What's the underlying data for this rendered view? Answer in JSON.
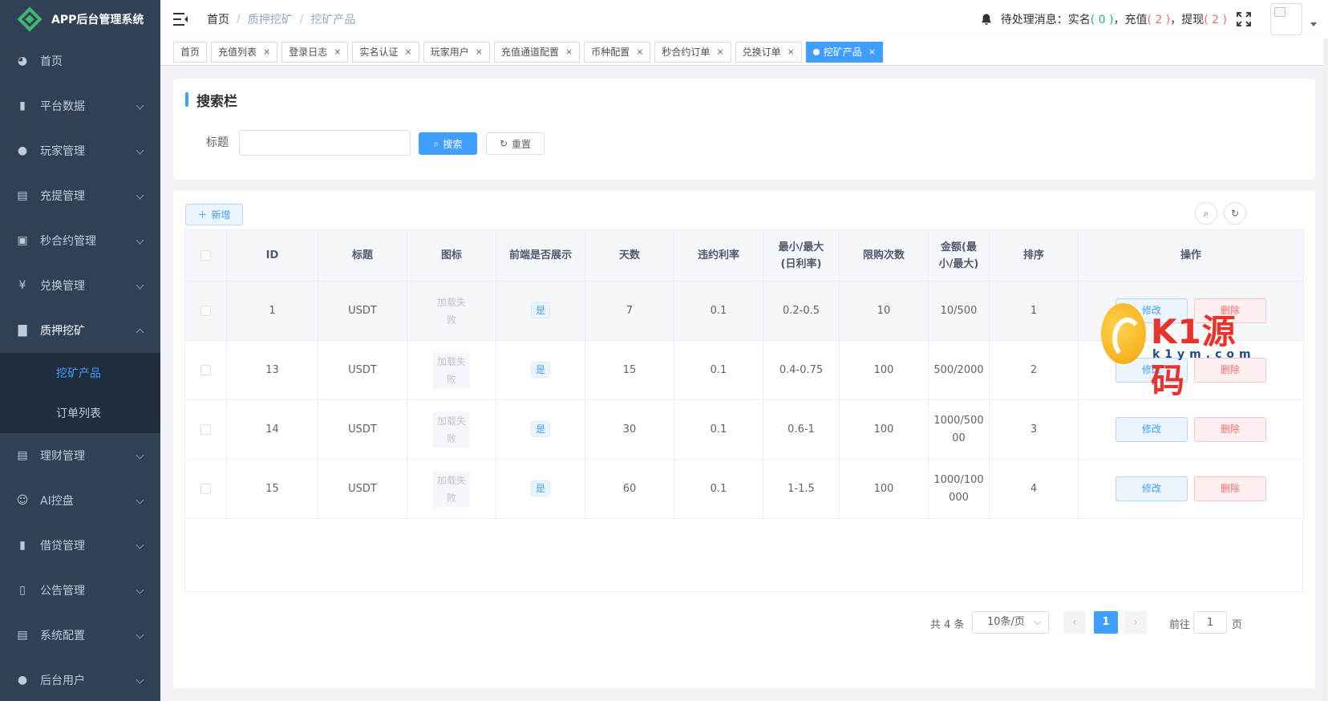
{
  "app": {
    "title": "APP后台管理系统"
  },
  "sidebar": {
    "items": [
      {
        "label": "首页",
        "icon": "dashboard-icon"
      },
      {
        "label": "平台数据",
        "icon": "book-icon"
      },
      {
        "label": "玩家管理",
        "icon": "user-icon"
      },
      {
        "label": "充提管理",
        "icon": "copy-icon"
      },
      {
        "label": "秒合约管理",
        "icon": "monitor-icon"
      },
      {
        "label": "兑换管理",
        "icon": "yen-icon"
      },
      {
        "label": "质押挖矿",
        "icon": "bar-chart-icon"
      },
      {
        "label": "理财管理",
        "icon": "document-icon"
      },
      {
        "label": "AI控盘",
        "icon": "robot-icon"
      },
      {
        "label": "借贷管理",
        "icon": "book-icon"
      },
      {
        "label": "公告管理",
        "icon": "open-book-icon"
      },
      {
        "label": "系统配置",
        "icon": "document-icon"
      },
      {
        "label": "后台用户",
        "icon": "users-icon"
      }
    ],
    "submenu": [
      {
        "label": "挖矿产品",
        "active": true
      },
      {
        "label": "订单列表",
        "active": false
      }
    ]
  },
  "header": {
    "breadcrumb": [
      "首页",
      "质押挖矿",
      "挖矿产品"
    ],
    "notice_label": "待处理消息：",
    "notice_realname": "实名",
    "notice_realname_count": "( 0 )",
    "notice_recharge": "，充值",
    "notice_recharge_count": "( 2 )",
    "notice_withdraw": "，提现",
    "notice_withdraw_count": "( 2 )"
  },
  "tags": [
    {
      "label": "首页",
      "closable": false,
      "active": false
    },
    {
      "label": "充值列表",
      "closable": true,
      "active": false
    },
    {
      "label": "登录日志",
      "closable": true,
      "active": false
    },
    {
      "label": "实名认证",
      "closable": true,
      "active": false
    },
    {
      "label": "玩家用户",
      "closable": true,
      "active": false
    },
    {
      "label": "充值通道配置",
      "closable": true,
      "active": false
    },
    {
      "label": "币种配置",
      "closable": true,
      "active": false
    },
    {
      "label": "秒合约订单",
      "closable": true,
      "active": false
    },
    {
      "label": "兑换订单",
      "closable": true,
      "active": false
    },
    {
      "label": "挖矿产品",
      "closable": true,
      "active": true
    }
  ],
  "search": {
    "title": "搜索栏",
    "field_label": "标题",
    "field_value": "",
    "search_button": "搜索",
    "reset_button": "重置"
  },
  "table": {
    "add_button": "新增",
    "columns": [
      "ID",
      "标题",
      "图标",
      "前端是否展示",
      "天数",
      "违约利率",
      "最小/最大\n(日利率)",
      "限购次数",
      "金额(最\n小/最大)",
      "排序",
      "操作"
    ],
    "image_failed": "加载失\n败",
    "edit_label": "修改",
    "delete_label": "删除",
    "rows": [
      {
        "id": "1",
        "title": "USDT",
        "show": "是",
        "days": "7",
        "penalty": "0.1",
        "rate": "0.2-0.5",
        "limit": "10",
        "amount": "10/500",
        "sort": "1"
      },
      {
        "id": "13",
        "title": "USDT",
        "show": "是",
        "days": "15",
        "penalty": "0.1",
        "rate": "0.4-0.75",
        "limit": "100",
        "amount": "500/2000",
        "sort": "2"
      },
      {
        "id": "14",
        "title": "USDT",
        "show": "是",
        "days": "30",
        "penalty": "0.1",
        "rate": "0.6-1",
        "limit": "100",
        "amount": "1000/500\n00",
        "sort": "3"
      },
      {
        "id": "15",
        "title": "USDT",
        "show": "是",
        "days": "60",
        "penalty": "0.1",
        "rate": "1-1.5",
        "limit": "100",
        "amount": "1000/100\n000",
        "sort": "4"
      }
    ]
  },
  "pagination": {
    "total": "共 4 条",
    "page_size": "10条/页",
    "current_page": "1",
    "goto_label": "前往",
    "goto_value": "1",
    "page_label": "页"
  },
  "watermark": {
    "text": "K1源码",
    "sub": "k1ym.com"
  },
  "colors": {
    "sidebar_bg": "#304156",
    "submenu_bg": "#1f2d3d",
    "primary": "#409eff",
    "danger": "#f56c6c",
    "success": "#19be6b"
  }
}
